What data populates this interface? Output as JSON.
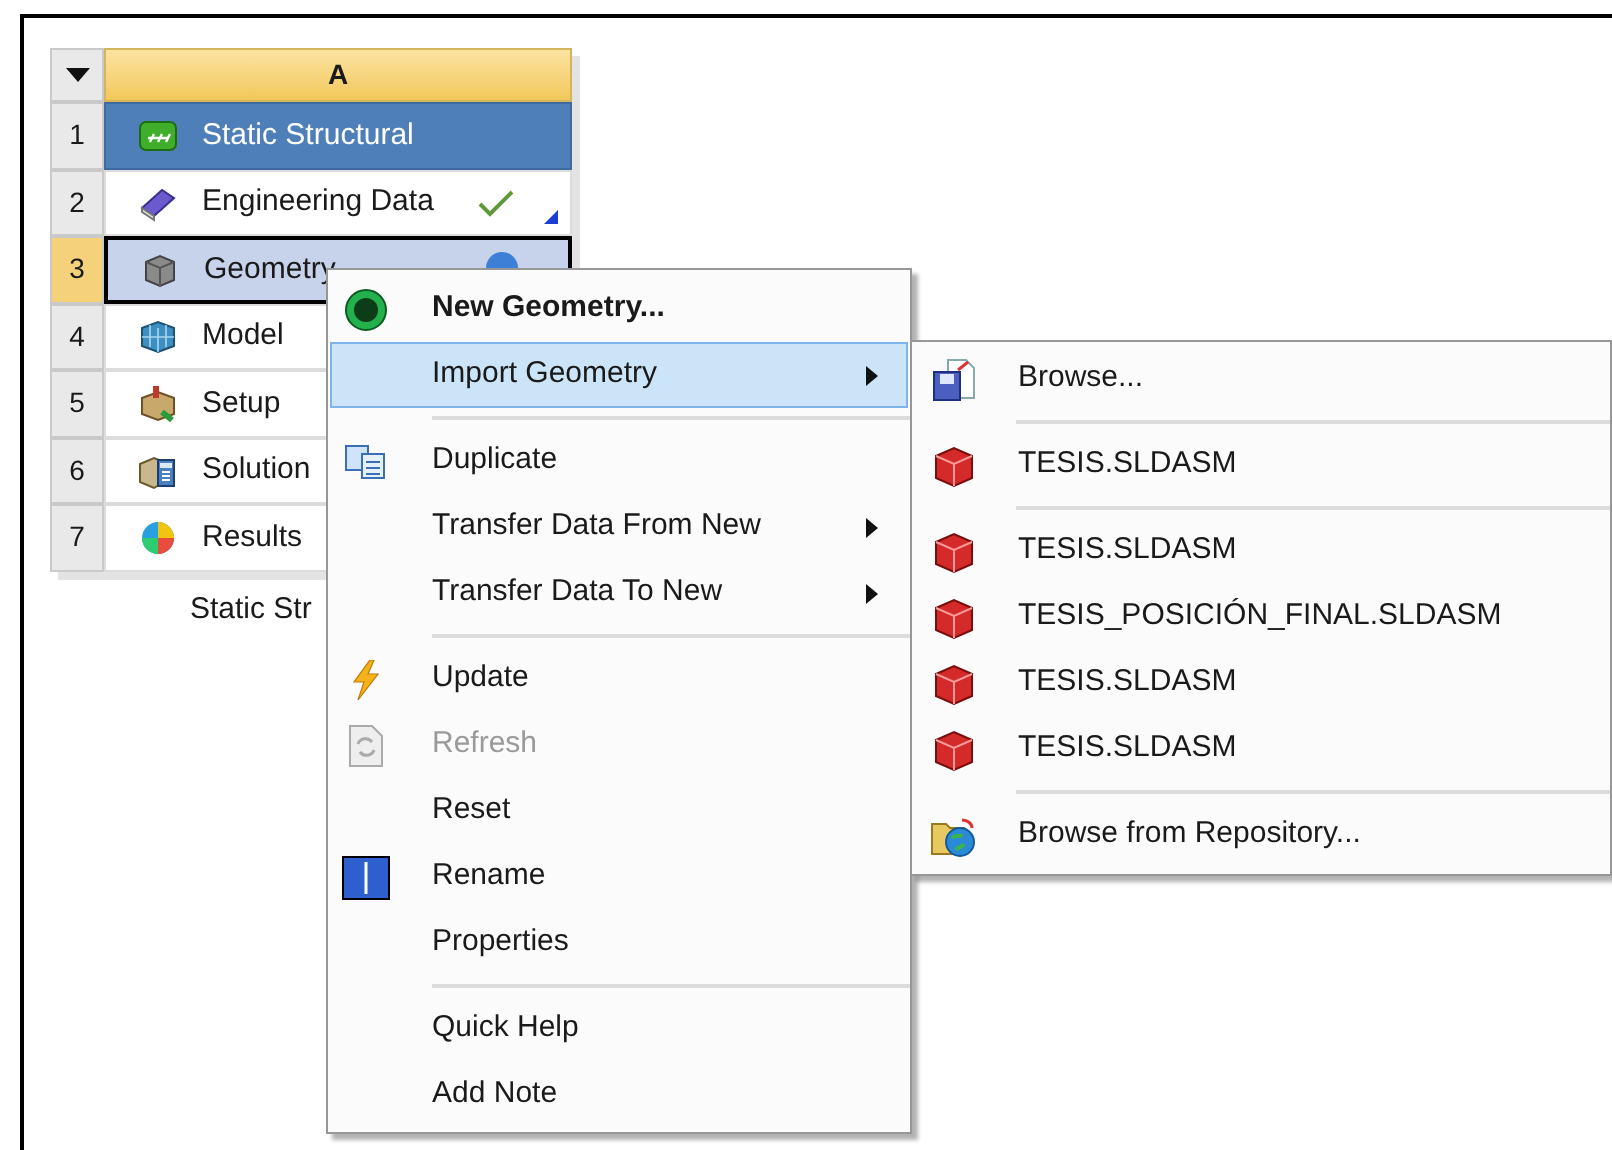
{
  "table": {
    "column_header": "A",
    "rows": [
      {
        "number": "1",
        "label": "Static Structural",
        "kind": "title",
        "selected": false
      },
      {
        "number": "2",
        "label": "Engineering Data",
        "kind": "checked",
        "selected": false
      },
      {
        "number": "3",
        "label": "Geometry",
        "kind": "attention",
        "selected": true
      },
      {
        "number": "4",
        "label": "Model",
        "kind": "cell",
        "selected": false
      },
      {
        "number": "5",
        "label": "Setup",
        "kind": "cell",
        "selected": false
      },
      {
        "number": "6",
        "label": "Solution",
        "kind": "cell",
        "selected": false
      },
      {
        "number": "7",
        "label": "Results",
        "kind": "cell",
        "selected": false
      }
    ],
    "caption": "Static Str"
  },
  "context_menu": {
    "groups": [
      {
        "items": [
          {
            "label": "New Geometry...",
            "default": true,
            "selected": false,
            "disabled": false,
            "submenu": false
          },
          {
            "label": "Import Geometry",
            "default": false,
            "selected": true,
            "disabled": false,
            "submenu": true
          }
        ]
      },
      {
        "items": [
          {
            "label": "Duplicate",
            "default": false,
            "selected": false,
            "disabled": false,
            "submenu": false
          },
          {
            "label": "Transfer Data From New",
            "default": false,
            "selected": false,
            "disabled": false,
            "submenu": true
          },
          {
            "label": "Transfer Data To New",
            "default": false,
            "selected": false,
            "disabled": false,
            "submenu": true
          }
        ]
      },
      {
        "items": [
          {
            "label": "Update",
            "default": false,
            "selected": false,
            "disabled": false,
            "submenu": false
          },
          {
            "label": "Refresh",
            "default": false,
            "selected": false,
            "disabled": true,
            "submenu": false
          },
          {
            "label": "Reset",
            "default": false,
            "selected": false,
            "disabled": false,
            "submenu": false
          },
          {
            "label": "Rename",
            "default": false,
            "selected": false,
            "disabled": false,
            "submenu": false
          },
          {
            "label": "Properties",
            "default": false,
            "selected": false,
            "disabled": false,
            "submenu": false
          }
        ]
      },
      {
        "items": [
          {
            "label": "Quick Help",
            "default": false,
            "selected": false,
            "disabled": false,
            "submenu": false
          },
          {
            "label": "Add Note",
            "default": false,
            "selected": false,
            "disabled": false,
            "submenu": false
          }
        ]
      }
    ]
  },
  "submenu": {
    "groups": [
      {
        "items": [
          {
            "label": "Browse..."
          }
        ]
      },
      {
        "items": [
          {
            "label": "TESIS.SLDASM"
          }
        ]
      },
      {
        "items": [
          {
            "label": "TESIS.SLDASM"
          },
          {
            "label": "TESIS_POSICIÓN_FINAL.SLDASM"
          },
          {
            "label": "TESIS.SLDASM"
          },
          {
            "label": "TESIS.SLDASM"
          }
        ]
      },
      {
        "items": [
          {
            "label": "Browse from Repository..."
          }
        ]
      }
    ]
  }
}
